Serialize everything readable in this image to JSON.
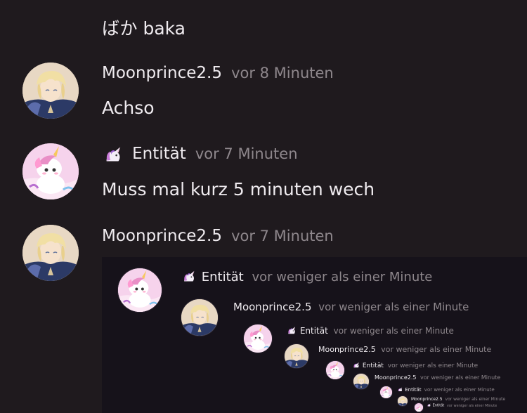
{
  "messages": [
    {
      "text": "ばか baka"
    },
    {
      "user": "Moonprince2.5",
      "time": "vor 8 Minuten",
      "text": "Achso"
    },
    {
      "user": "Entität",
      "time": "vor 7 Minuten",
      "text": "Muss mal kurz 5 minuten wech"
    },
    {
      "user": "Moonprince2.5",
      "time": "vor 7 Minuten"
    }
  ],
  "embed": {
    "rows": [
      {
        "user": "Entität",
        "time": "vor weniger als einer Minute"
      },
      {
        "user": "Moonprince2.5",
        "time": "vor weniger als einer Minute"
      },
      {
        "user": "Entität",
        "time": "vor weniger als einer Minute"
      },
      {
        "user": "Moonprince2.5",
        "time": "vor weniger als einer Minute"
      },
      {
        "user": "Entität",
        "time": "vor weniger als einer Minute"
      },
      {
        "user": "Moonprince2.5",
        "time": "vor weniger als einer Minute"
      },
      {
        "user": "Entität",
        "time": "vor weniger als einer Minute"
      },
      {
        "user": "Moonprince2.5",
        "time": "vor weniger als einer Minute"
      },
      {
        "user": "Entität",
        "time": "vor weniger als einer Minute"
      }
    ]
  },
  "icons": {
    "unicorn": "unicorn-icon",
    "avatar_unicorn": "unicorn-avatar",
    "avatar_prince": "anime-prince-avatar"
  },
  "colors": {
    "background": "#1f1a1e",
    "text": "#efebef",
    "meta": "#8e878c"
  }
}
